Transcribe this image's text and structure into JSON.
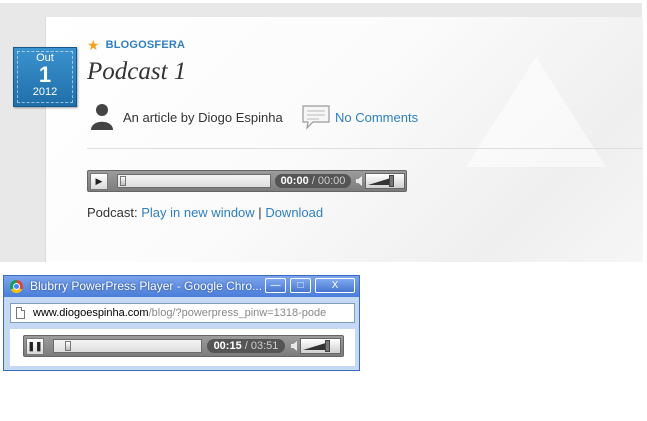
{
  "post": {
    "date": {
      "month": "Out",
      "day": "1",
      "year": "2012"
    },
    "category": "BLOGOSFERA",
    "title": "Podcast 1",
    "author_text": "An article by Diogo Espinha",
    "comments_label": "No Comments"
  },
  "player_main": {
    "time_current": "00:00",
    "time_separator": "/",
    "time_total": "00:00",
    "progress": 0.0
  },
  "podcast_links": {
    "prefix": "Podcast:",
    "play_new_window": "Play in new window",
    "separator": "|",
    "download": "Download"
  },
  "popup": {
    "title": "Blubrry PowerPress Player - Google Chro...",
    "minimize": "—",
    "maximize": "□",
    "close": "X",
    "url_domain": "www.diogoespinha.com",
    "url_path": "/blog/?powerpress_pinw=1318-pode",
    "player": {
      "time_current": "00:15",
      "time_separator": "/",
      "time_total": "03:51",
      "progress": 0.065
    }
  },
  "colors": {
    "accent_blue": "#2e7fc1",
    "badge_blue": "#2a80bf",
    "star": "#f0a21e",
    "window_title": "#4b7ed9"
  },
  "icons": {
    "star": "star-icon",
    "author": "person-icon",
    "comments": "speech-bubble-icon",
    "browser": "chrome-icon",
    "page": "page-icon"
  }
}
